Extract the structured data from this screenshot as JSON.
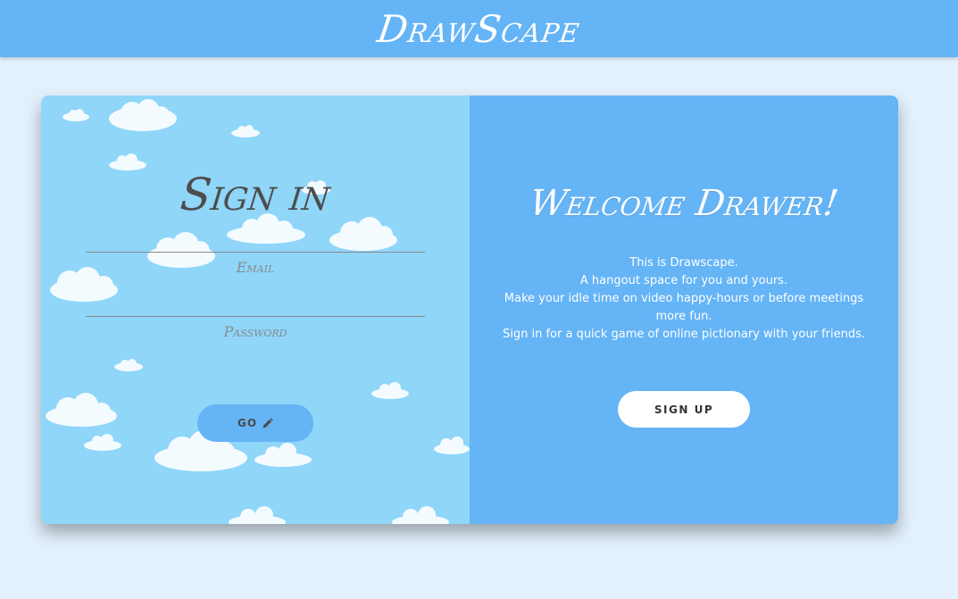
{
  "header": {
    "brand": "DrawScape"
  },
  "signin": {
    "title": "Sign in",
    "email_placeholder": "Email",
    "password_placeholder": "Password",
    "go_label": "GO",
    "go_icon": "pencil-icon"
  },
  "welcome": {
    "title": "Welcome Drawer!",
    "lines": [
      "This is Drawscape.",
      "A hangout space for you and yours.",
      "Make your idle time on video happy-hours or before meetings",
      "more fun.",
      "Sign in for a quick game of online pictionary with your friends."
    ],
    "signup_label": "SIGN UP"
  },
  "colors": {
    "header_bg": "#64b4f6",
    "page_bg": "#e3f1fd",
    "left_panel_bg": "#8fd6f9",
    "right_panel_bg": "#64b4f6",
    "cloud": "#f4fbff"
  }
}
